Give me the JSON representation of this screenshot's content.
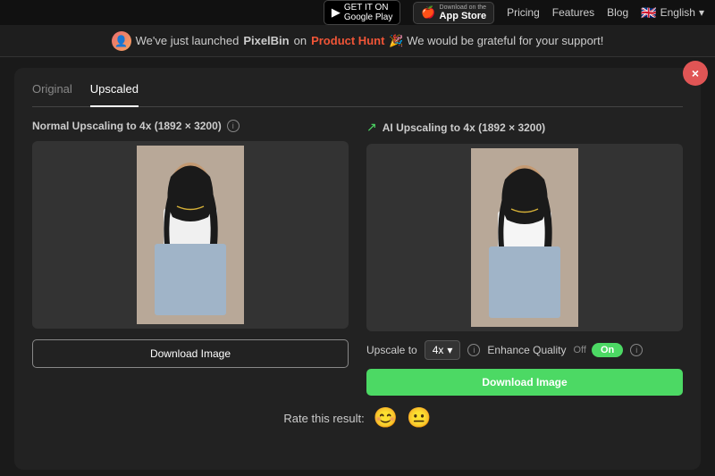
{
  "nav": {
    "gplay_label_top": "GET IT ON",
    "gplay_label_main": "Google Play",
    "appstore_label_top": "Download on the",
    "appstore_label_main": "App Store",
    "links": [
      "Pricing",
      "Features",
      "Blog"
    ],
    "lang": "English"
  },
  "banner": {
    "text_before": "We've just launched",
    "brand": "PixelBin",
    "text_on": "on",
    "platform": "Product Hunt",
    "text_after": "🎉 We would be grateful for your support!"
  },
  "main": {
    "close_label": "×",
    "tabs": [
      {
        "label": "Original",
        "active": false
      },
      {
        "label": "Upscaled",
        "active": true
      }
    ],
    "left_panel": {
      "title": "Normal Upscaling to 4x (1892 × 3200)",
      "download_btn": "Download Image"
    },
    "right_panel": {
      "ai_icon": "↗",
      "title": "AI Upscaling to 4x (1892 × 3200)",
      "upscale_label": "Upscale to",
      "upscale_value": "4x",
      "enhance_label": "Enhance Quality",
      "toggle_off": "Off",
      "toggle_on": "On",
      "download_btn": "Download Image"
    },
    "rating": {
      "label": "Rate this result:",
      "emoji_good": "😊",
      "emoji_neutral": "😐"
    }
  }
}
